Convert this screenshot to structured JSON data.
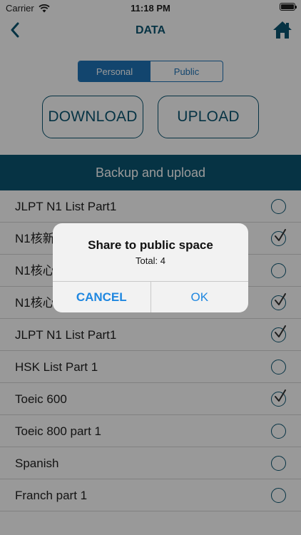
{
  "status_bar": {
    "carrier": "Carrier",
    "time": "11:18 PM"
  },
  "nav": {
    "title": "DATA",
    "back_icon": "chevron-left-icon",
    "home_icon": "home-icon"
  },
  "segments": {
    "personal": "Personal",
    "public": "Public",
    "selected": "Personal"
  },
  "actions": {
    "download": "DOWNLOAD",
    "upload": "UPLOAD"
  },
  "section_header": "Backup and upload",
  "list": {
    "items": [
      {
        "label": "JLPT N1 List Part1",
        "checked": false
      },
      {
        "label": "N1核新",
        "checked": true
      },
      {
        "label": "N1核心",
        "checked": false
      },
      {
        "label": "N1核心",
        "checked": true
      },
      {
        "label": "JLPT N1 List Part1",
        "checked": true
      },
      {
        "label": "HSK List Part 1",
        "checked": false
      },
      {
        "label": "Toeic 600",
        "checked": true
      },
      {
        "label": "Toeic 800 part 1",
        "checked": false
      },
      {
        "label": "Spanish",
        "checked": false
      },
      {
        "label": "Franch part 1",
        "checked": false
      }
    ]
  },
  "dialog": {
    "title": "Share to public space",
    "message": "Total: 4",
    "cancel": "CANCEL",
    "ok": "OK"
  },
  "colors": {
    "primary": "#0b5672",
    "segment_accent": "#1f74b8",
    "dialog_button": "#1f87e0"
  }
}
